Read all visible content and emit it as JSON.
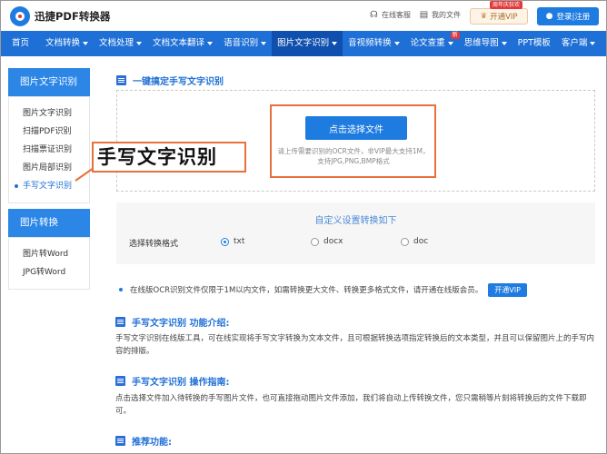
{
  "header": {
    "app_name": "迅捷PDF转换器",
    "service_link": "在线客服",
    "files_link": "我的文件",
    "vip_badge": "周年庆狂欢",
    "vip_button": "开通VIP",
    "login_button": "登录|注册"
  },
  "nav": {
    "items": [
      {
        "label": "首页",
        "has_caret": false
      },
      {
        "label": "文档转换",
        "has_caret": true
      },
      {
        "label": "文档处理",
        "has_caret": true
      },
      {
        "label": "文档文本翻译",
        "has_caret": true
      },
      {
        "label": "语音识别",
        "has_caret": true
      },
      {
        "label": "图片文字识别",
        "has_caret": true,
        "active": true
      },
      {
        "label": "音视频转换",
        "has_caret": true
      },
      {
        "label": "论文查重",
        "has_caret": true,
        "tag": "新"
      },
      {
        "label": "思维导图",
        "has_caret": true
      },
      {
        "label": "PPT模板",
        "has_caret": false
      },
      {
        "label": "客户端",
        "has_caret": true
      }
    ]
  },
  "sidebar": {
    "group1_title": "图片文字识别",
    "group1_items": [
      "图片文字识别",
      "扫描PDF识别",
      "扫描票证识别",
      "图片局部识别",
      "手写文字识别"
    ],
    "group2_title": "图片转换",
    "group2_items": [
      "图片转Word",
      "JPG转Word"
    ]
  },
  "main": {
    "section_title": "一键搞定手写文字识别",
    "upload_button": "点击选择文件",
    "upload_hint": "请上传需要识别的OCR文件，非VIP最大支持1M，支持JPG,PNG,BMP格式",
    "callout": "手写文字识别",
    "settings_title": "自定义设置转换如下",
    "settings_label": "选择转换格式",
    "formats": [
      {
        "label": "txt",
        "selected": true
      },
      {
        "label": "docx",
        "selected": false
      },
      {
        "label": "doc",
        "selected": false
      }
    ],
    "notice": "在线版OCR识别文件仅限于1M以内文件，如需转换更大文件、转换更多格式文件，请开通在线版会员。",
    "notice_button": "开通VIP",
    "intro_title": "手写文字识别 功能介绍:",
    "intro_text": "手写文字识别在线版工具，可在线实现将手写文字转换为文本文件，且可根据转换选项指定转换后的文本类型，并且可以保留图片上的手写内容的排版。",
    "guide_title": "手写文字识别 操作指南:",
    "guide_text": "点击选择文件加入待转换的手写图片文件，也可直接拖动图片文件添加，我们将自动上传转换文件，您只需稍等片刻将转换后的文件下载即可。",
    "recommend_title": "推荐功能:"
  }
}
